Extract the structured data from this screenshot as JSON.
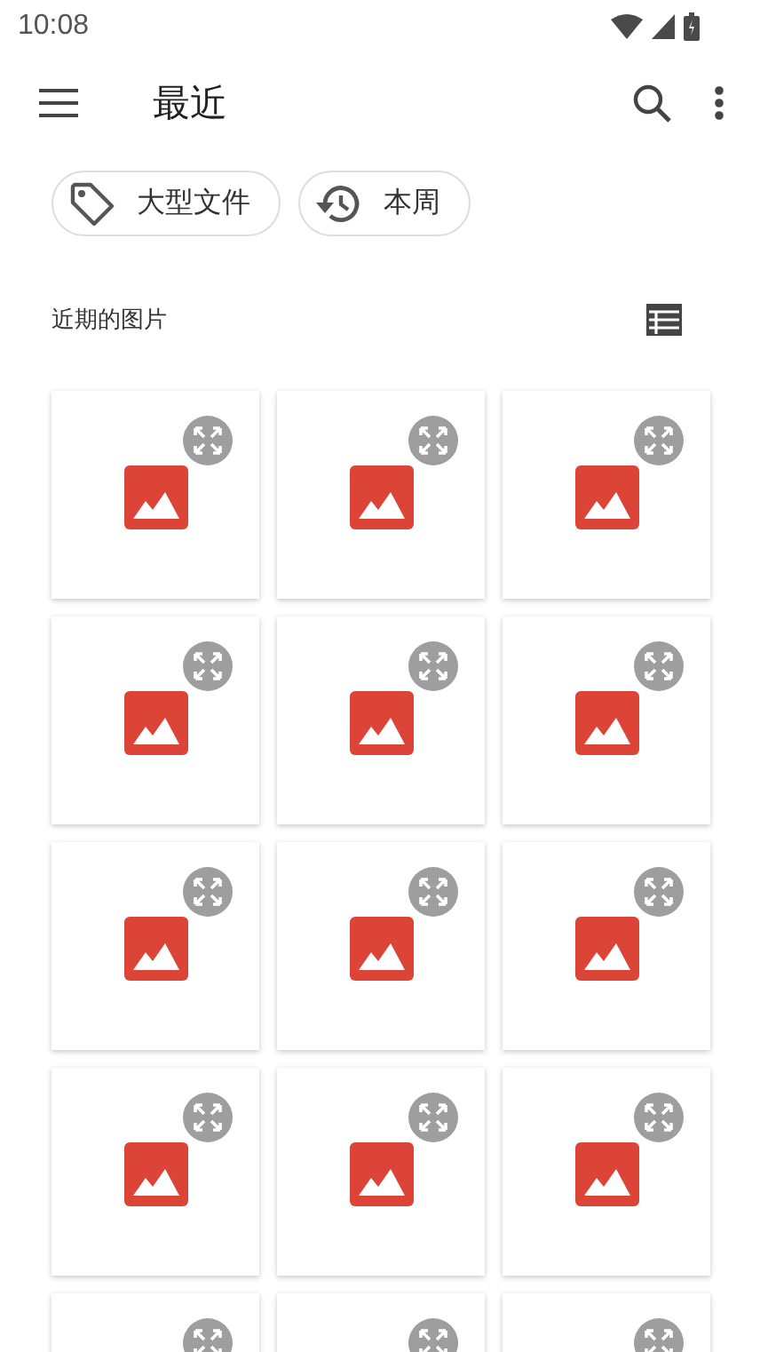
{
  "status_bar": {
    "time": "10:08"
  },
  "app_bar": {
    "title": "最近"
  },
  "chips": [
    {
      "label": "大型文件",
      "kind": "tag"
    },
    {
      "label": "本周",
      "kind": "history"
    }
  ],
  "section": {
    "title": "近期的图片"
  },
  "thumbnails": [
    {
      "kind": "image"
    },
    {
      "kind": "image"
    },
    {
      "kind": "image"
    },
    {
      "kind": "image"
    },
    {
      "kind": "image"
    },
    {
      "kind": "image"
    },
    {
      "kind": "image"
    },
    {
      "kind": "image"
    },
    {
      "kind": "image"
    },
    {
      "kind": "image"
    },
    {
      "kind": "image"
    },
    {
      "kind": "image"
    },
    {
      "kind": "partial"
    },
    {
      "kind": "partial"
    },
    {
      "kind": "partial"
    }
  ]
}
